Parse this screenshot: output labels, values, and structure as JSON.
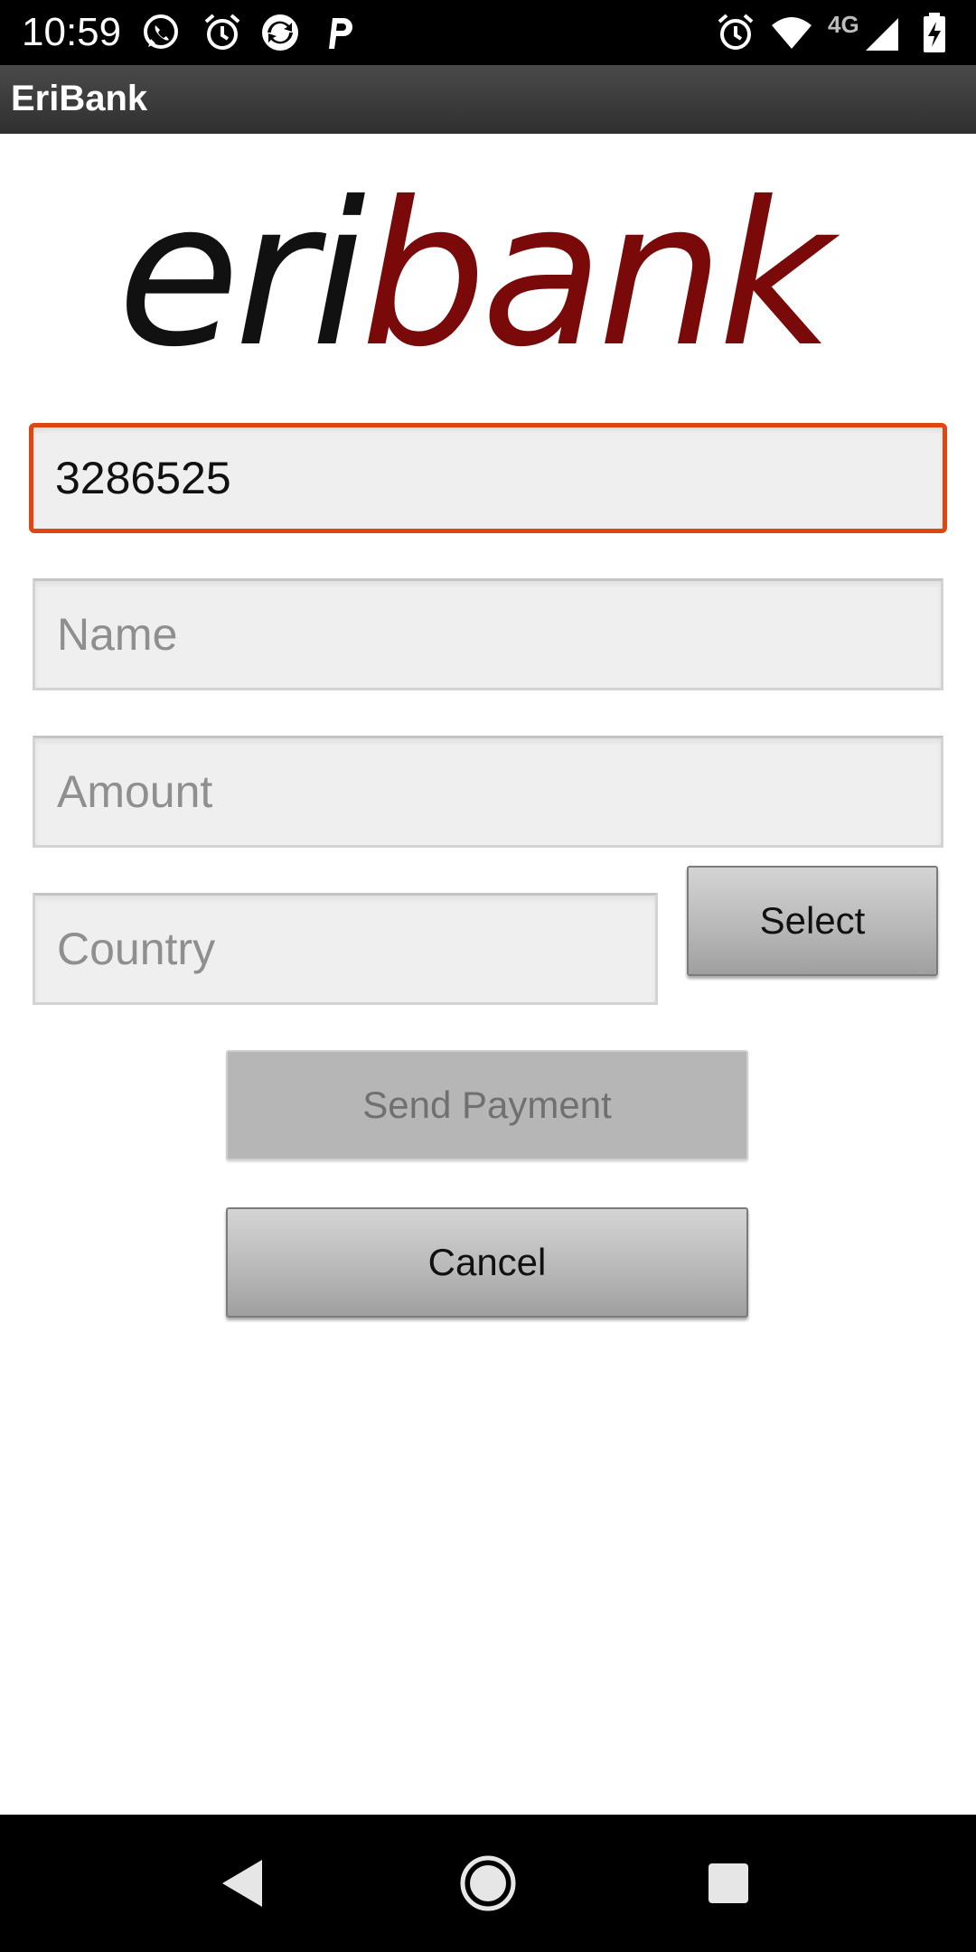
{
  "status_bar": {
    "time": "10:59",
    "network_label": "4G",
    "left_icons": [
      "whatsapp-icon",
      "alarm-icon",
      "sync-app-icon",
      "parking-app-icon"
    ],
    "right_icons": [
      "alarm-icon",
      "wifi-icon",
      "cell-signal-icon",
      "battery-charging-icon"
    ]
  },
  "app_bar": {
    "title": "EriBank"
  },
  "logo": {
    "text_part1": "eri",
    "text_part2": "bank",
    "color_part1": "#111111",
    "color_part2": "#7a0a0a"
  },
  "form": {
    "account": {
      "value": "3286525",
      "placeholder": ""
    },
    "name": {
      "value": "",
      "placeholder": "Name"
    },
    "amount": {
      "value": "",
      "placeholder": "Amount"
    },
    "country": {
      "value": "",
      "placeholder": "Country"
    },
    "select_label": "Select",
    "send_payment_label": "Send Payment",
    "cancel_label": "Cancel"
  },
  "colors": {
    "focus_border": "#e0460f",
    "field_bg": "#efefef",
    "disabled_text": "#707070"
  },
  "nav_bar": {
    "buttons": [
      "back-icon",
      "home-icon",
      "recents-icon"
    ]
  }
}
